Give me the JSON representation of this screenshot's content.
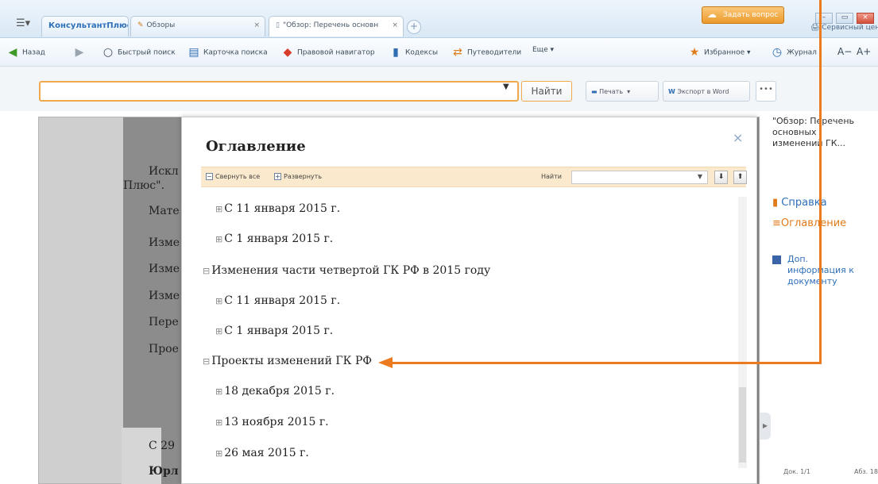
{
  "tabs": {
    "brand": "КонсультантПлюс",
    "tab1": "Обзоры",
    "tab2": "\"Обзор: Перечень основн"
  },
  "window": {
    "ask_question": "Задать вопрос",
    "service_center": "Сервисный центр"
  },
  "toolbar": {
    "back": "Назад",
    "quick_search": "Быстрый поиск",
    "search_card": "Карточка поиска",
    "legal_navigator": "Правовой навигатор",
    "codes": "Кодексы",
    "guides": "Путеводители",
    "more": "Еще ▾",
    "favorites": "Избранное ▾",
    "journal": "Журнал",
    "font_minus": "A−",
    "font_plus": "A+"
  },
  "search": {
    "find": "Найти",
    "print": "Печать",
    "export_word": "Экспорт в Word",
    "more": "•••"
  },
  "doc_fragments": {
    "f1": "Искл",
    "f2": "Плюс\".",
    "f3": "Мате",
    "f4": "Изме",
    "f5": "Изме",
    "f6": "Изме",
    "f7": "Пере",
    "f8": "Прое",
    "f9": "С 29",
    "f10": "Юрл"
  },
  "toc": {
    "title": "Оглавление",
    "collapse_all": "Свернуть все",
    "expand_all": "Развернуть",
    "find_label": "Найти",
    "items": [
      {
        "exp": "⊞",
        "text": "С 11 января 2015 г."
      },
      {
        "exp": "⊞",
        "text": "С 1 января 2015 г."
      },
      {
        "exp": "⊟",
        "text": "Изменения части четвертой ГК РФ в 2015 году"
      },
      {
        "exp": "⊞",
        "text": "С 11 января 2015 г."
      },
      {
        "exp": "⊞",
        "text": "С 1 января 2015 г."
      },
      {
        "exp": "⊟",
        "text": "Проекты изменений ГК РФ"
      },
      {
        "exp": "⊞",
        "text": "18 декабря 2015 г."
      },
      {
        "exp": "⊞",
        "text": "13 ноября 2015 г."
      },
      {
        "exp": "⊞",
        "text": "26 мая 2015 г."
      }
    ]
  },
  "right_panel": {
    "doc_title": "\"Обзор: Перечень основных изменений ГК...",
    "help": "Справка",
    "contents": "Оглавление",
    "extra_info": "Доп. информация к документу",
    "doc_count": "Док. 1/1",
    "para": "Абз. 18"
  },
  "colors": {
    "accent_orange": "#ec7a1f",
    "link_blue": "#2d6fb8",
    "search_border": "#f0a94c"
  }
}
